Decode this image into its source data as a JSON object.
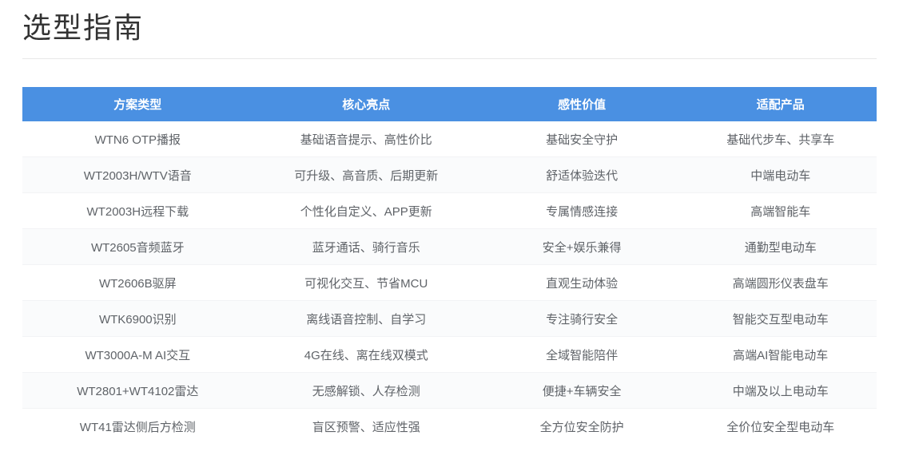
{
  "page": {
    "title": "选型指南"
  },
  "table": {
    "headers": {
      "scheme": "方案类型",
      "highlight": "核心亮点",
      "value": "感性价值",
      "product": "适配产品"
    },
    "rows": [
      {
        "scheme": "WTN6 OTP播报",
        "highlight": "基础语音提示、高性价比",
        "value": "基础安全守护",
        "product": "基础代步车、共享车"
      },
      {
        "scheme": "WT2003H/WTV语音",
        "highlight": "可升级、高音质、后期更新",
        "value": "舒适体验迭代",
        "product": "中端电动车"
      },
      {
        "scheme": "WT2003H远程下载",
        "highlight": "个性化自定义、APP更新",
        "value": "专属情感连接",
        "product": "高端智能车"
      },
      {
        "scheme": "WT2605音频蓝牙",
        "highlight": "蓝牙通话、骑行音乐",
        "value": "安全+娱乐兼得",
        "product": "通勤型电动车"
      },
      {
        "scheme": "WT2606B驱屏",
        "highlight": "可视化交互、节省MCU",
        "value": "直观生动体验",
        "product": "高端圆形仪表盘车"
      },
      {
        "scheme": "WTK6900识别",
        "highlight": "离线语音控制、自学习",
        "value": "专注骑行安全",
        "product": "智能交互型电动车"
      },
      {
        "scheme": "WT3000A-M AI交互",
        "highlight": "4G在线、离在线双模式",
        "value": "全域智能陪伴",
        "product": "高端AI智能电动车"
      },
      {
        "scheme": "WT2801+WT4102雷达",
        "highlight": "无感解锁、人存检测",
        "value": "便捷+车辆安全",
        "product": "中端及以上电动车"
      },
      {
        "scheme": "WT41雷达侧后方检测",
        "highlight": "盲区预警、适应性强",
        "value": "全方位安全防护",
        "product": "全价位安全型电动车"
      }
    ],
    "colors": {
      "header_bg": "#4a90e2",
      "header_text": "#ffffff",
      "body_text": "#5f6368",
      "stripe_bg": "#fafbfc",
      "row_border": "#f2f3f5"
    }
  }
}
